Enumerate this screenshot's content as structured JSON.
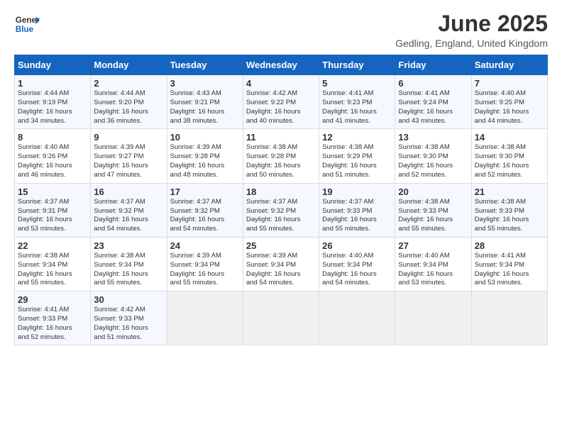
{
  "header": {
    "logo_general": "General",
    "logo_blue": "Blue",
    "title": "June 2025",
    "subtitle": "Gedling, England, United Kingdom"
  },
  "weekdays": [
    "Sunday",
    "Monday",
    "Tuesday",
    "Wednesday",
    "Thursday",
    "Friday",
    "Saturday"
  ],
  "weeks": [
    [
      {
        "day": "1",
        "info": "Sunrise: 4:44 AM\nSunset: 9:19 PM\nDaylight: 16 hours\nand 34 minutes."
      },
      {
        "day": "2",
        "info": "Sunrise: 4:44 AM\nSunset: 9:20 PM\nDaylight: 16 hours\nand 36 minutes."
      },
      {
        "day": "3",
        "info": "Sunrise: 4:43 AM\nSunset: 9:21 PM\nDaylight: 16 hours\nand 38 minutes."
      },
      {
        "day": "4",
        "info": "Sunrise: 4:42 AM\nSunset: 9:22 PM\nDaylight: 16 hours\nand 40 minutes."
      },
      {
        "day": "5",
        "info": "Sunrise: 4:41 AM\nSunset: 9:23 PM\nDaylight: 16 hours\nand 41 minutes."
      },
      {
        "day": "6",
        "info": "Sunrise: 4:41 AM\nSunset: 9:24 PM\nDaylight: 16 hours\nand 43 minutes."
      },
      {
        "day": "7",
        "info": "Sunrise: 4:40 AM\nSunset: 9:25 PM\nDaylight: 16 hours\nand 44 minutes."
      }
    ],
    [
      {
        "day": "8",
        "info": "Sunrise: 4:40 AM\nSunset: 9:26 PM\nDaylight: 16 hours\nand 46 minutes."
      },
      {
        "day": "9",
        "info": "Sunrise: 4:39 AM\nSunset: 9:27 PM\nDaylight: 16 hours\nand 47 minutes."
      },
      {
        "day": "10",
        "info": "Sunrise: 4:39 AM\nSunset: 9:28 PM\nDaylight: 16 hours\nand 48 minutes."
      },
      {
        "day": "11",
        "info": "Sunrise: 4:38 AM\nSunset: 9:28 PM\nDaylight: 16 hours\nand 50 minutes."
      },
      {
        "day": "12",
        "info": "Sunrise: 4:38 AM\nSunset: 9:29 PM\nDaylight: 16 hours\nand 51 minutes."
      },
      {
        "day": "13",
        "info": "Sunrise: 4:38 AM\nSunset: 9:30 PM\nDaylight: 16 hours\nand 52 minutes."
      },
      {
        "day": "14",
        "info": "Sunrise: 4:38 AM\nSunset: 9:30 PM\nDaylight: 16 hours\nand 52 minutes."
      }
    ],
    [
      {
        "day": "15",
        "info": "Sunrise: 4:37 AM\nSunset: 9:31 PM\nDaylight: 16 hours\nand 53 minutes."
      },
      {
        "day": "16",
        "info": "Sunrise: 4:37 AM\nSunset: 9:32 PM\nDaylight: 16 hours\nand 54 minutes."
      },
      {
        "day": "17",
        "info": "Sunrise: 4:37 AM\nSunset: 9:32 PM\nDaylight: 16 hours\nand 54 minutes."
      },
      {
        "day": "18",
        "info": "Sunrise: 4:37 AM\nSunset: 9:32 PM\nDaylight: 16 hours\nand 55 minutes."
      },
      {
        "day": "19",
        "info": "Sunrise: 4:37 AM\nSunset: 9:33 PM\nDaylight: 16 hours\nand 55 minutes."
      },
      {
        "day": "20",
        "info": "Sunrise: 4:38 AM\nSunset: 9:33 PM\nDaylight: 16 hours\nand 55 minutes."
      },
      {
        "day": "21",
        "info": "Sunrise: 4:38 AM\nSunset: 9:33 PM\nDaylight: 16 hours\nand 55 minutes."
      }
    ],
    [
      {
        "day": "22",
        "info": "Sunrise: 4:38 AM\nSunset: 9:34 PM\nDaylight: 16 hours\nand 55 minutes."
      },
      {
        "day": "23",
        "info": "Sunrise: 4:38 AM\nSunset: 9:34 PM\nDaylight: 16 hours\nand 55 minutes."
      },
      {
        "day": "24",
        "info": "Sunrise: 4:39 AM\nSunset: 9:34 PM\nDaylight: 16 hours\nand 55 minutes."
      },
      {
        "day": "25",
        "info": "Sunrise: 4:39 AM\nSunset: 9:34 PM\nDaylight: 16 hours\nand 54 minutes."
      },
      {
        "day": "26",
        "info": "Sunrise: 4:40 AM\nSunset: 9:34 PM\nDaylight: 16 hours\nand 54 minutes."
      },
      {
        "day": "27",
        "info": "Sunrise: 4:40 AM\nSunset: 9:34 PM\nDaylight: 16 hours\nand 53 minutes."
      },
      {
        "day": "28",
        "info": "Sunrise: 4:41 AM\nSunset: 9:34 PM\nDaylight: 16 hours\nand 53 minutes."
      }
    ],
    [
      {
        "day": "29",
        "info": "Sunrise: 4:41 AM\nSunset: 9:33 PM\nDaylight: 16 hours\nand 52 minutes."
      },
      {
        "day": "30",
        "info": "Sunrise: 4:42 AM\nSunset: 9:33 PM\nDaylight: 16 hours\nand 51 minutes."
      },
      {
        "day": "",
        "info": ""
      },
      {
        "day": "",
        "info": ""
      },
      {
        "day": "",
        "info": ""
      },
      {
        "day": "",
        "info": ""
      },
      {
        "day": "",
        "info": ""
      }
    ]
  ]
}
